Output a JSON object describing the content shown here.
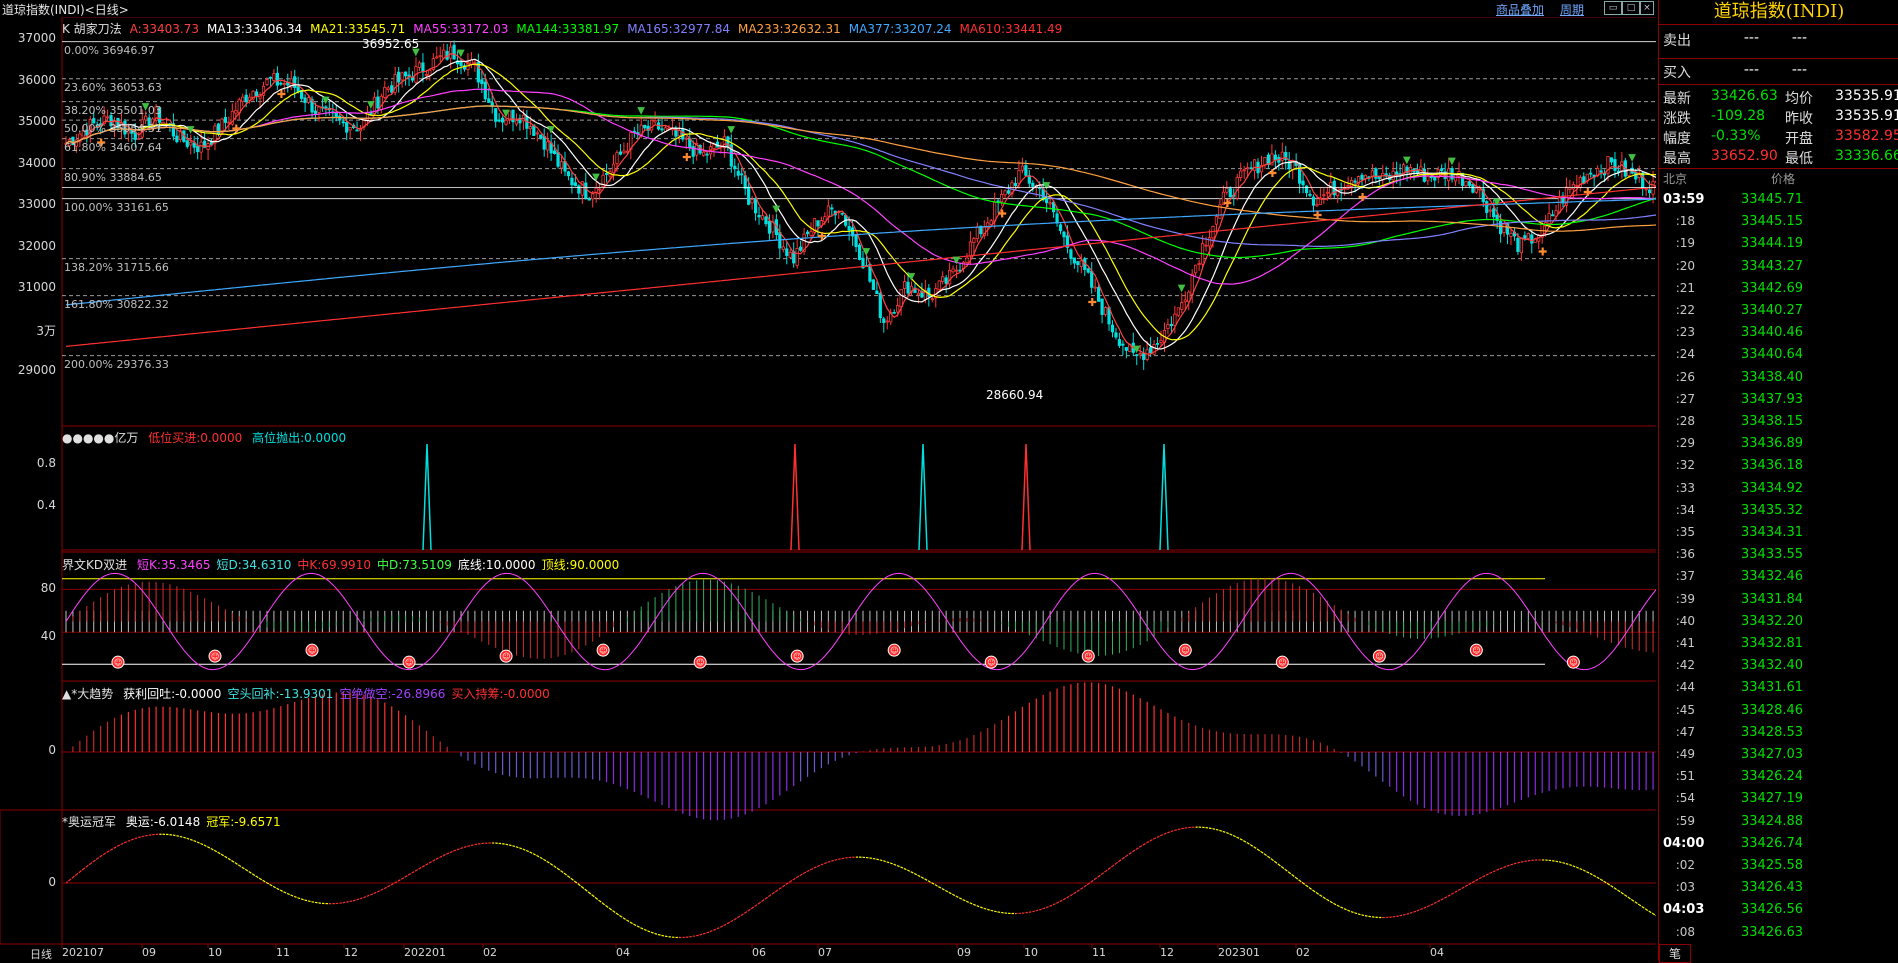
{
  "window": {
    "title": "道琼指数(INDI)<日线>",
    "buttons": [
      "商品叠加",
      "周期"
    ],
    "icons": [
      "window-tile-icon",
      "window-maximize-icon",
      "window-close-icon"
    ]
  },
  "main_chart": {
    "ma_legend": [
      {
        "text": "K  胡家刀法",
        "color": "#e0e0e0"
      },
      {
        "text": "A:33403.73",
        "color": "#ff4040"
      },
      {
        "text": "MA13:33406.34",
        "color": "#ffffff"
      },
      {
        "text": "MA21:33545.71",
        "color": "#ffff00"
      },
      {
        "text": "MA55:33172.03",
        "color": "#ff40ff"
      },
      {
        "text": "MA144:33381.97",
        "color": "#00ff00"
      },
      {
        "text": "MA165:32977.84",
        "color": "#8080ff"
      },
      {
        "text": "MA233:32632.31",
        "color": "#ffa040"
      },
      {
        "text": "MA377:33207.24",
        "color": "#3fa9ff"
      },
      {
        "text": "MA610:33441.49",
        "color": "#ff3030"
      }
    ],
    "y_axis": [
      "37000",
      "36000",
      "35000",
      "34000",
      "33000",
      "32000",
      "31000",
      "3万",
      "29000"
    ],
    "fib_levels": [
      "0.00% 36946.97",
      "23.60% 36053.63",
      "38.20% 35501.03",
      "50.00% 35054.31",
      "61.80% 34607.64",
      "80.90% 33884.65",
      "100.00% 33161.65",
      "138.20% 31715.66",
      "161.80% 30822.32",
      "200.00% 29376.33"
    ],
    "annotations": {
      "high": "36952.65",
      "low": "28660.94"
    }
  },
  "indicator1": {
    "title": "●●●●●亿万",
    "fields": [
      {
        "text": "低位买进:0.0000",
        "color": "#ff3030"
      },
      {
        "text": "高位抛出:0.0000",
        "color": "#00e0e0"
      }
    ],
    "y_axis": [
      "0.8",
      "0.4"
    ]
  },
  "indicator2": {
    "title": "界文KD双进",
    "fields": [
      {
        "text": "短K:35.3465",
        "color": "#ff40ff"
      },
      {
        "text": "短D:34.6310",
        "color": "#40e0e0"
      },
      {
        "text": "中K:69.9910",
        "color": "#ff3030"
      },
      {
        "text": "中D:73.5109",
        "color": "#40ff40"
      },
      {
        "text": "底线:10.0000",
        "color": "#ffffff"
      },
      {
        "text": "顶线:90.0000",
        "color": "#ffff00"
      }
    ],
    "y_axis": [
      "80",
      "40"
    ]
  },
  "indicator3": {
    "title": "▲*大趋势",
    "fields": [
      {
        "text": "获利回吐:-0.0000",
        "color": "#ffffff"
      },
      {
        "text": "空头回补:-13.9301",
        "color": "#40e0e0"
      },
      {
        "text": "空绝做空:-26.8966",
        "color": "#a040ff"
      },
      {
        "text": "买入持筹:-0.0000",
        "color": "#ff3030"
      }
    ],
    "y_axis": [
      "0"
    ]
  },
  "indicator4": {
    "title": "*奥运冠军",
    "fields": [
      {
        "text": "奥运:-6.0148",
        "color": "#ffffff"
      },
      {
        "text": "冠军:-9.6571",
        "color": "#ffff00"
      }
    ],
    "y_axis": [
      "0"
    ]
  },
  "x_axis": {
    "label": "日线",
    "ticks": [
      "202107",
      "09",
      "10",
      "11",
      "12",
      "202201",
      "02",
      "04",
      "06",
      "07",
      "09",
      "10",
      "11",
      "12",
      "202301",
      "02",
      "04"
    ]
  },
  "quote_panel": {
    "title": "道琼指数(INDI)",
    "sell": {
      "label": "卖出",
      "v1": "---",
      "v2": "---"
    },
    "buy": {
      "label": "买入",
      "v1": "---",
      "v2": "---"
    },
    "stats": [
      {
        "l1": "最新",
        "v1": "33426.63",
        "c1": "#00e000",
        "l2": "均价",
        "v2": "33535.91",
        "c2": "#ffffff"
      },
      {
        "l1": "涨跌",
        "v1": "-109.28",
        "c1": "#00e000",
        "l2": "昨收",
        "v2": "33535.91",
        "c2": "#ffffff"
      },
      {
        "l1": "幅度",
        "v1": "-0.33%",
        "c1": "#00e000",
        "l2": "开盘",
        "v2": "33582.95",
        "c2": "#ff3030"
      },
      {
        "l1": "最高",
        "v1": "33652.90",
        "c1": "#ff3030",
        "l2": "最低",
        "v2": "33336.66",
        "c2": "#00e000"
      }
    ],
    "tick_header": {
      "time": "北京",
      "price": "价格"
    },
    "ticks": [
      {
        "time": "03:59",
        "price": "33445.71"
      },
      {
        "time": ":18",
        "price": "33445.15"
      },
      {
        "time": ":19",
        "price": "33444.19"
      },
      {
        "time": ":20",
        "price": "33443.27"
      },
      {
        "time": ":21",
        "price": "33442.69"
      },
      {
        "time": ":22",
        "price": "33440.27"
      },
      {
        "time": ":23",
        "price": "33440.46"
      },
      {
        "time": ":24",
        "price": "33440.64"
      },
      {
        "time": ":26",
        "price": "33438.40"
      },
      {
        "time": ":27",
        "price": "33437.93"
      },
      {
        "time": ":28",
        "price": "33438.15"
      },
      {
        "time": ":29",
        "price": "33436.89"
      },
      {
        "time": ":32",
        "price": "33436.18"
      },
      {
        "time": ":33",
        "price": "33434.92"
      },
      {
        "time": ":34",
        "price": "33435.32"
      },
      {
        "time": ":35",
        "price": "33434.31"
      },
      {
        "time": ":36",
        "price": "33433.55"
      },
      {
        "time": ":37",
        "price": "33432.46"
      },
      {
        "time": ":39",
        "price": "33431.84"
      },
      {
        "time": ":40",
        "price": "33432.20"
      },
      {
        "time": ":41",
        "price": "33432.81"
      },
      {
        "time": ":42",
        "price": "33432.40"
      },
      {
        "time": ":44",
        "price": "33431.61"
      },
      {
        "time": ":45",
        "price": "33428.46"
      },
      {
        "time": ":47",
        "price": "33428.53"
      },
      {
        "time": ":49",
        "price": "33427.03"
      },
      {
        "time": ":51",
        "price": "33426.24"
      },
      {
        "time": ":54",
        "price": "33427.19"
      },
      {
        "time": ":59",
        "price": "33424.88"
      },
      {
        "time": "04:00",
        "price": "33426.74"
      },
      {
        "time": ":02",
        "price": "33425.58"
      },
      {
        "time": ":03",
        "price": "33426.43"
      },
      {
        "time": "04:03",
        "price": "33426.56"
      },
      {
        "time": ":08",
        "price": "33426.63"
      }
    ],
    "bottom_tab": "笔"
  },
  "chart_data": {
    "type": "candlestick",
    "title": "道琼指数(INDI)<日线>",
    "x_ticks": [
      "202107",
      "09",
      "10",
      "11",
      "12",
      "202201",
      "02",
      "04",
      "06",
      "07",
      "09",
      "10",
      "11",
      "12",
      "202301",
      "02",
      "04"
    ],
    "ylim": [
      28500,
      37300
    ],
    "approx_close_series": [
      34500,
      34900,
      35100,
      34700,
      35200,
      34600,
      34400,
      35000,
      35700,
      36000,
      35900,
      35300,
      35000,
      34900,
      35800,
      36100,
      36400,
      36700,
      36300,
      35100,
      35200,
      34600,
      33700,
      33300,
      33900,
      34700,
      34900,
      34600,
      34200,
      34500,
      33200,
      32500,
      31700,
      32600,
      33000,
      31800,
      30200,
      31100,
      30800,
      31300,
      32200,
      33000,
      33800,
      33300,
      32100,
      31200,
      30100,
      29300,
      29700,
      30500,
      32000,
      33200,
      33800,
      34200,
      34000,
      33100,
      33500,
      33800,
      33600,
      33900,
      33700,
      33800,
      33500,
      32600,
      32000,
      32400,
      33300,
      33800,
      34000,
      33700,
      33427
    ],
    "extremes": {
      "high": 36952.65,
      "low": 28660.94
    },
    "last": 33426.63
  }
}
